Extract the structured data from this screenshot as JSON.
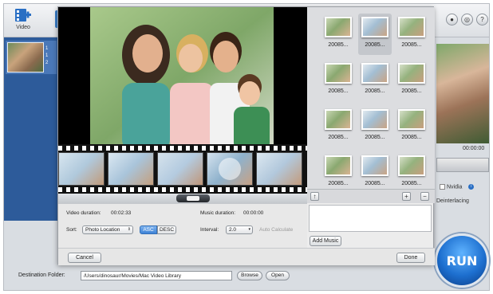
{
  "toolbar": {
    "video_label": "Video",
    "icons": [
      "add-video-icon",
      "account-icon",
      "settings-icon",
      "help-icon"
    ],
    "help_glyph": "?",
    "account_glyph": "●",
    "settings_glyph": "◎"
  },
  "preview": {
    "time": "00:00:00",
    "nvidia": "Nvidia",
    "deinterlacing": "Deinterlacing"
  },
  "run": {
    "label": "RUN"
  },
  "destination": {
    "label": "Destination Folder:",
    "path": "/Users/dinosaur/Movies/Mac Video Library",
    "browse": "Browse",
    "open": "Open"
  },
  "slideshow": {
    "video_duration_label": "Video duration:",
    "video_duration": "00:02:33",
    "music_duration_label": "Music duration:",
    "music_duration": "00:00:00",
    "sort_label": "Sort:",
    "sort_value": "Photo Location",
    "asc": "ASC",
    "desc": "DESC",
    "interval_label": "Interval:",
    "interval_value": "2.0",
    "auto_calculate": "Auto Calculate",
    "add_music": "Add Music",
    "cancel": "Cancel",
    "done": "Done",
    "thumbnails": [
      "20085...",
      "20085...",
      "20085...",
      "20085...",
      "20085...",
      "20085...",
      "20085...",
      "20085...",
      "20085...",
      "20085...",
      "20085...",
      "20085..."
    ],
    "plus": "+",
    "minus": "−"
  },
  "colors": {
    "accent": "#3d82d6",
    "run": "#1d6fcf",
    "sidebar": "#2d5b9a"
  }
}
